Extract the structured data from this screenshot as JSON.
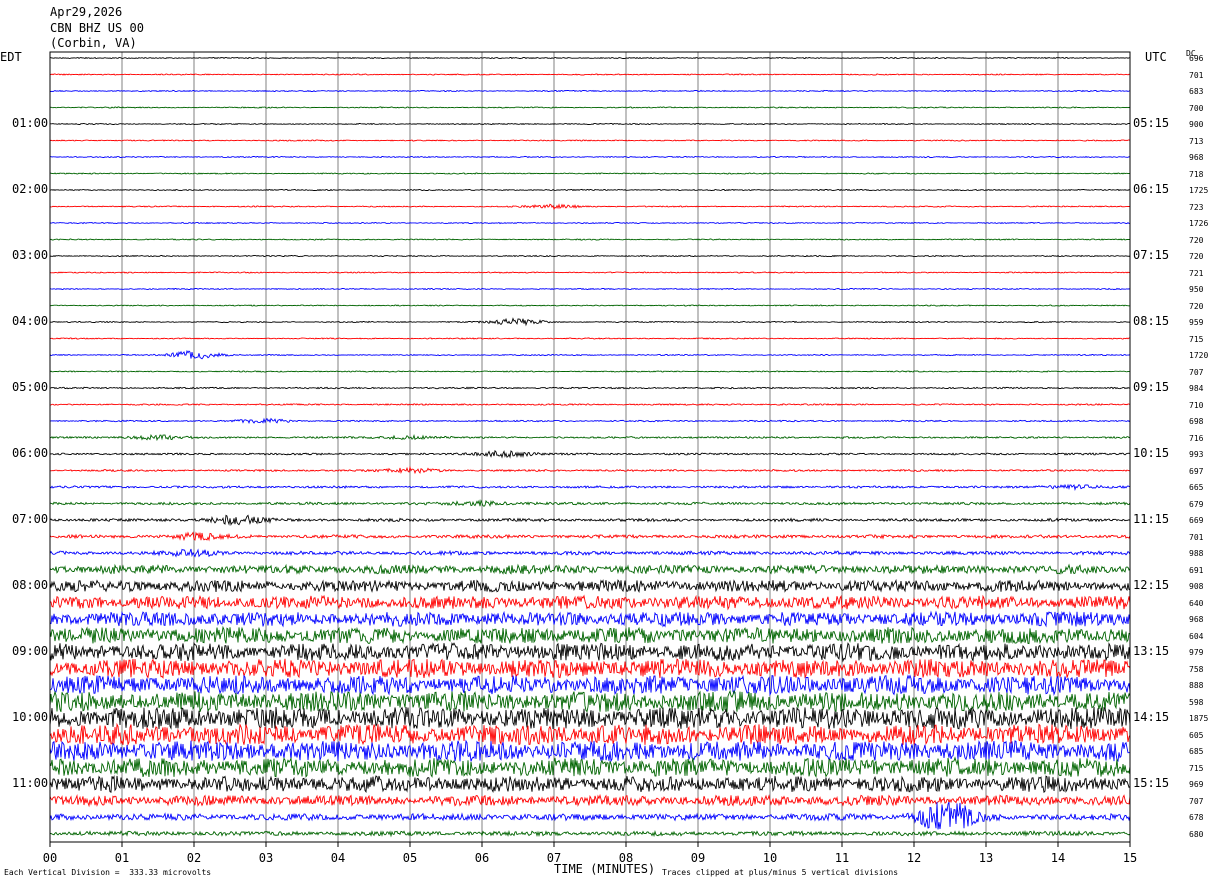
{
  "header": {
    "date": "Apr29,2026",
    "station": "CBN BHZ US 00",
    "location": "(Corbin, VA)"
  },
  "labels": {
    "left_tz": "EDT",
    "right_tz": "UTC",
    "dc_header": "DC"
  },
  "chart_data": {
    "type": "line",
    "title": "CBN BHZ US 00 (Corbin, VA) Apr29,2026",
    "xlabel": "TIME (MINUTES)",
    "xlim": [
      0,
      15
    ],
    "x_ticks": [
      "00",
      "01",
      "02",
      "03",
      "04",
      "05",
      "06",
      "07",
      "08",
      "09",
      "10",
      "11",
      "12",
      "13",
      "14",
      "15"
    ],
    "rows_per_hour": 4,
    "trace_colors": [
      "#000000",
      "#ff0000",
      "#0000ff",
      "#006400"
    ],
    "edt_hour_labels": [
      "01:00",
      "02:00",
      "03:00",
      "04:00",
      "05:00",
      "06:00",
      "07:00",
      "08:00",
      "09:00",
      "10:00",
      "11:00"
    ],
    "utc_labels": [
      "05:15",
      "06:15",
      "07:15",
      "08:15",
      "09:15",
      "10:15",
      "11:15",
      "12:15",
      "13:15",
      "14:15",
      "15:15"
    ],
    "dc_values": [
      "696",
      "701",
      "683",
      "700",
      "900",
      "713",
      "968",
      "718",
      "1725",
      "723",
      "1726",
      "720",
      "720",
      "721",
      "950",
      "720",
      "959",
      "715",
      "1720",
      "707",
      "984",
      "710",
      "698",
      "716",
      "993",
      "697",
      "665",
      "679",
      "669",
      "701",
      "988",
      "691",
      "908",
      "640",
      "968",
      "604",
      "979",
      "758",
      "888",
      "598",
      "1875",
      "605",
      "685",
      "715",
      "969",
      "707",
      "678",
      "680"
    ],
    "trace_amplitude_vdiv": [
      0.15,
      0.15,
      0.15,
      0.15,
      0.15,
      0.15,
      0.15,
      0.15,
      0.15,
      0.15,
      0.15,
      0.15,
      0.15,
      0.15,
      0.15,
      0.15,
      0.15,
      0.15,
      0.15,
      0.15,
      0.2,
      0.2,
      0.2,
      0.25,
      0.25,
      0.25,
      0.3,
      0.35,
      0.4,
      0.45,
      0.5,
      1.2,
      1.6,
      1.8,
      2.0,
      2.2,
      2.4,
      2.6,
      2.6,
      2.8,
      3.0,
      2.8,
      2.8,
      2.6,
      2.2,
      1.4,
      0.9,
      0.6
    ],
    "events": [
      {
        "trace": 9,
        "minute": 7.0,
        "amp": 0.7
      },
      {
        "trace": 16,
        "minute": 6.5,
        "amp": 1.0
      },
      {
        "trace": 18,
        "minute": 2.0,
        "amp": 1.3
      },
      {
        "trace": 22,
        "minute": 3.0,
        "amp": 0.6
      },
      {
        "trace": 23,
        "minute": 1.5,
        "amp": 0.7
      },
      {
        "trace": 23,
        "minute": 5.0,
        "amp": 0.5
      },
      {
        "trace": 24,
        "minute": 6.3,
        "amp": 1.0
      },
      {
        "trace": 25,
        "minute": 5.0,
        "amp": 0.8
      },
      {
        "trace": 26,
        "minute": 14.2,
        "amp": 0.6
      },
      {
        "trace": 27,
        "minute": 6.0,
        "amp": 0.6
      },
      {
        "trace": 28,
        "minute": 2.6,
        "amp": 1.4
      },
      {
        "trace": 29,
        "minute": 2.0,
        "amp": 0.8
      },
      {
        "trace": 30,
        "minute": 2.0,
        "amp": 0.8
      },
      {
        "trace": 46,
        "minute": 12.45,
        "amp": 5.0
      }
    ],
    "grid": true
  },
  "footer": {
    "scale": "Each Vertical Division =  333.33 microvolts",
    "xlabel": "TIME (MINUTES)",
    "clip_note": "Traces clipped at plus/minus 5 vertical divisions"
  }
}
